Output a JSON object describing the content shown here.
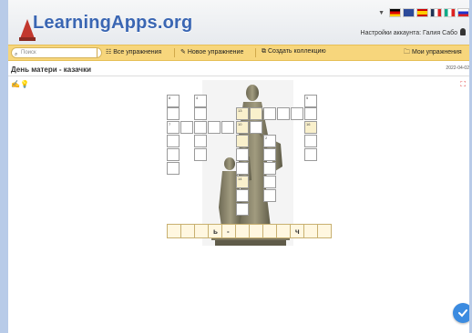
{
  "brand": {
    "name": "LearningApps.org"
  },
  "account": {
    "label": "Настройки аккаунта: Галия Сабо"
  },
  "nav": {
    "search_placeholder": "Поиск",
    "all_exercises": "Все упражнения",
    "new_exercise": "Новое упражнение",
    "create_collection": "Создать коллекцию",
    "my_exercises": "Мои упражнения"
  },
  "exercise": {
    "title": "День матери - казачки",
    "date": "2022-04-02"
  },
  "crossword": {
    "numbers": [
      "8",
      "4",
      "5",
      "13",
      "7",
      "10",
      "2",
      "14",
      "16"
    ],
    "answer_letters": [
      "ь",
      "-",
      "ч"
    ]
  },
  "colors": {
    "accent": "#3a66b3",
    "nav_bar": "#f7d67c",
    "fab": "#3b8be0"
  },
  "icons": [
    "search-icon",
    "grid-icon",
    "pencil-icon",
    "collection-icon",
    "folder-icon",
    "edit-icon",
    "lightbulb-icon",
    "fullscreen-icon",
    "check-icon",
    "user-icon"
  ]
}
